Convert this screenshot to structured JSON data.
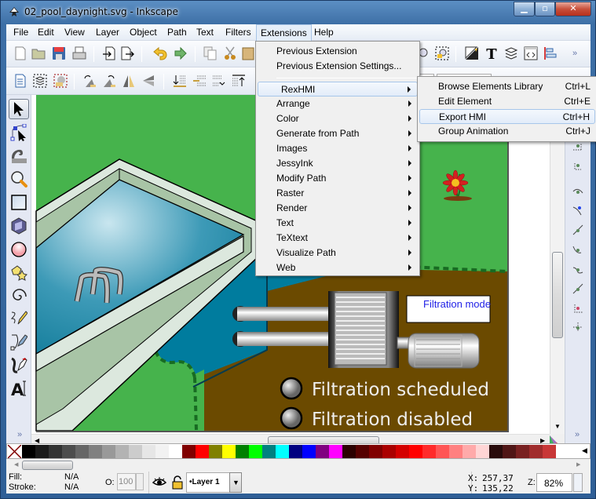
{
  "window": {
    "title": "02_pool_daynight.svg - Inkscape",
    "controls": {
      "minimize": "minimize",
      "maximize": "maximize",
      "close": "close"
    }
  },
  "menubar": {
    "items": [
      {
        "label": "File"
      },
      {
        "label": "Edit"
      },
      {
        "label": "View"
      },
      {
        "label": "Layer"
      },
      {
        "label": "Object"
      },
      {
        "label": "Path"
      },
      {
        "label": "Text"
      },
      {
        "label": "Filters"
      },
      {
        "label": "Extensions",
        "active": true
      },
      {
        "label": "Help"
      }
    ]
  },
  "commands_toolbar": {
    "icons": [
      "new-document-icon",
      "open-icon",
      "save-icon",
      "print-icon",
      "import-icon",
      "export-icon",
      "undo-icon",
      "redo-icon",
      "duplicate-icon",
      "cut-icon",
      "paste-icon",
      "zoom-selection-icon",
      "zoom-drawing-icon",
      "fill-stroke-icon",
      "text-font-icon",
      "layers-icon",
      "xml-editor-icon",
      "align-distribute-icon"
    ],
    "overflow": "»"
  },
  "controls_toolbar": {
    "icons": [
      "select-all-icon",
      "select-all-layers-icon",
      "deselect-icon",
      "rotate-ccw-icon",
      "rotate-cw-icon",
      "flip-horizontal-icon",
      "flip-vertical-icon",
      "lower-bottom-icon",
      "lower-icon",
      "raise-icon",
      "raise-top-icon"
    ]
  },
  "extensions_menu": {
    "items": [
      {
        "label": "Previous Extension",
        "submenu": false
      },
      {
        "label": "Previous Extension Settings...",
        "submenu": false
      },
      {
        "separator": true
      },
      {
        "label": "RexHMI",
        "submenu": true,
        "highlighted": true
      },
      {
        "label": "Arrange",
        "submenu": true
      },
      {
        "label": "Color",
        "submenu": true
      },
      {
        "label": "Generate from Path",
        "submenu": true
      },
      {
        "label": "Images",
        "submenu": true
      },
      {
        "label": "JessyInk",
        "submenu": true
      },
      {
        "label": "Modify Path",
        "submenu": true
      },
      {
        "label": "Raster",
        "submenu": true
      },
      {
        "label": "Render",
        "submenu": true
      },
      {
        "label": "Text",
        "submenu": true
      },
      {
        "label": "TeXtext",
        "submenu": true
      },
      {
        "label": "Visualize Path",
        "submenu": true
      },
      {
        "label": "Web",
        "submenu": true
      }
    ]
  },
  "rexhmi_submenu": {
    "items": [
      {
        "label": "Browse Elements Library",
        "shortcut": "Ctrl+L"
      },
      {
        "label": "Edit Element",
        "shortcut": "Ctrl+E"
      },
      {
        "label": "Export HMI",
        "shortcut": "Ctrl+H",
        "highlighted": true
      },
      {
        "label": "Group Animation",
        "shortcut": "Ctrl+J"
      }
    ]
  },
  "toolbox": {
    "tools": [
      "selector-tool-icon",
      "node-tool-icon",
      "tweak-tool-icon",
      "zoom-tool-icon",
      "rectangle-tool-icon",
      "3d-box-tool-icon",
      "ellipse-tool-icon",
      "star-tool-icon",
      "spiral-tool-icon",
      "pencil-tool-icon",
      "pen-tool-icon",
      "calligraphy-tool-icon",
      "text-tool-icon"
    ],
    "selected": 0,
    "overflow": "»"
  },
  "snap_toolbar": {
    "icons": [
      "snap-bbox-icon",
      "snap-bbox-edge-icon",
      "snap-bbox-corner-icon",
      "snap-bbox-midpoint-icon",
      "snap-nodes-icon",
      "snap-path-icon",
      "snap-intersection-icon",
      "snap-smooth-icon",
      "snap-midpoint-icon",
      "snap-center-icon",
      "snap-rotation-center-icon",
      "snap-page-icon"
    ],
    "overflow": "»"
  },
  "canvas": {
    "labels": {
      "filtration_mode": "Filtration mode",
      "filtration_scheduled": "Filtration scheduled",
      "filtration_disabled": "Filtration disabled"
    },
    "colors": {
      "grass": "#46b34c",
      "water": "#007c9e",
      "soil": "#6b4a00",
      "text_blue": "#1e1ee6"
    }
  },
  "palette": {
    "none_swatch": "none",
    "colors": [
      "#000000",
      "#1a1a1a",
      "#333333",
      "#4d4d4d",
      "#666666",
      "#808080",
      "#999999",
      "#b3b3b3",
      "#cccccc",
      "#e6e6e6",
      "#f2f2f2",
      "#ffffff",
      "#800000",
      "#ff0000",
      "#808000",
      "#ffff00",
      "#008000",
      "#00ff00",
      "#008080",
      "#00ffff",
      "#000080",
      "#0000ff",
      "#800080",
      "#ff00ff",
      "#2b0000",
      "#550000",
      "#800000",
      "#aa0000",
      "#d40000",
      "#ff0000",
      "#ff2a2a",
      "#ff5555",
      "#ff8080",
      "#ffaaaa",
      "#ffd5d5",
      "#280b0b",
      "#501616",
      "#782121",
      "#a02c2c",
      "#c83737"
    ]
  },
  "statusbar": {
    "fill_label": "Fill:",
    "fill_value": "N/A",
    "stroke_label": "Stroke:",
    "stroke_value": "N/A",
    "opacity_label": "O:",
    "opacity_value": "100",
    "layer": "•Layer 1",
    "x_label": "X:",
    "x_value": "257,37",
    "y_label": "Y:",
    "y_value": "135,22",
    "zoom_label": "Z:",
    "zoom_value": "82%"
  }
}
